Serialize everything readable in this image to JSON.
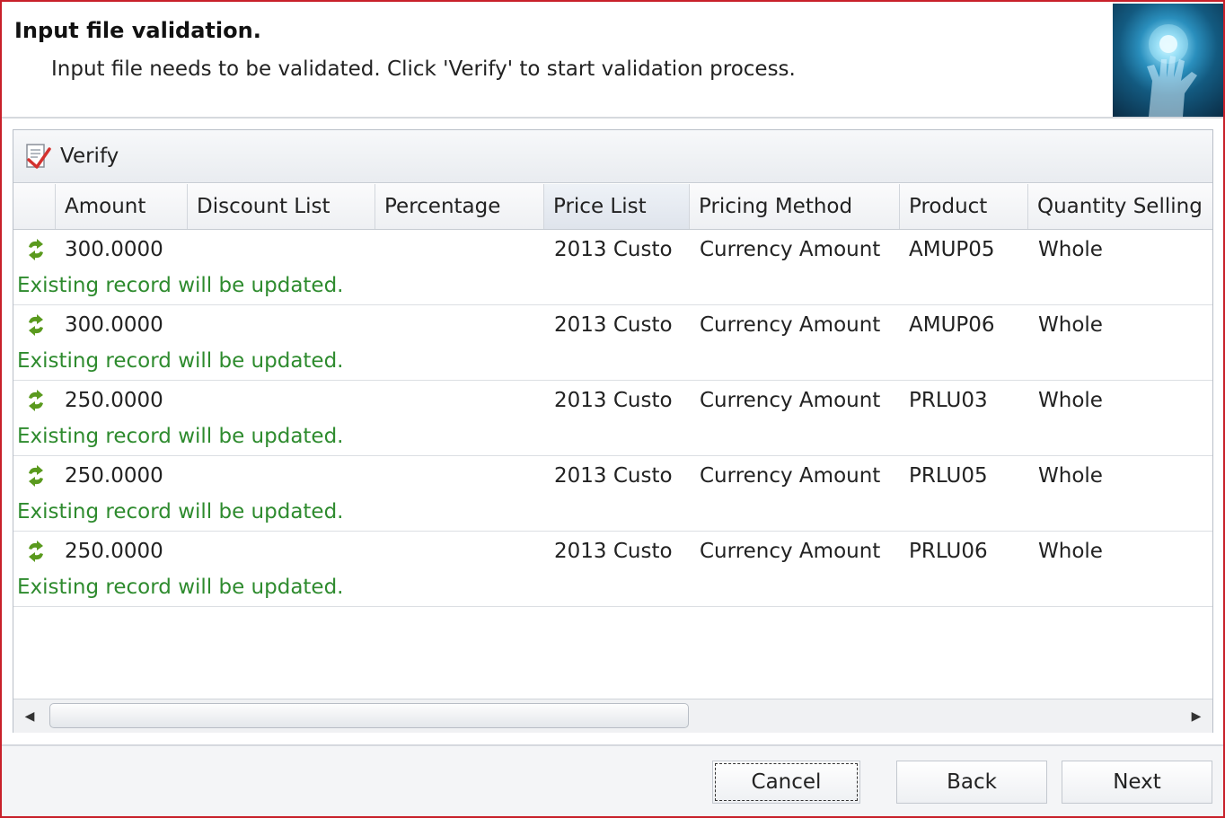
{
  "header": {
    "title": "Input file validation.",
    "description": "Input file needs to be validated. Click 'Verify' to start validation process."
  },
  "toolbar": {
    "verify_label": "Verify"
  },
  "grid": {
    "columns": [
      "Amount",
      "Discount List",
      "Percentage",
      "Price List",
      "Pricing Method",
      "Product",
      "Quantity Selling"
    ],
    "selected_column": "Price List",
    "rows": [
      {
        "amount": "300.0000",
        "discount_list": "",
        "percentage": "",
        "price_list": "2013 Custo",
        "pricing_method": "Currency Amount",
        "product": "AMUP05",
        "quantity_selling": "Whole",
        "message": "Existing record will be updated."
      },
      {
        "amount": "300.0000",
        "discount_list": "",
        "percentage": "",
        "price_list": "2013 Custo",
        "pricing_method": "Currency Amount",
        "product": "AMUP06",
        "quantity_selling": "Whole",
        "message": "Existing record will be updated."
      },
      {
        "amount": "250.0000",
        "discount_list": "",
        "percentage": "",
        "price_list": "2013 Custo",
        "pricing_method": "Currency Amount",
        "product": "PRLU03",
        "quantity_selling": "Whole",
        "message": "Existing record will be updated."
      },
      {
        "amount": "250.0000",
        "discount_list": "",
        "percentage": "",
        "price_list": "2013 Custo",
        "pricing_method": "Currency Amount",
        "product": "PRLU05",
        "quantity_selling": "Whole",
        "message": "Existing record will be updated."
      },
      {
        "amount": "250.0000",
        "discount_list": "",
        "percentage": "",
        "price_list": "2013 Custo",
        "pricing_method": "Currency Amount",
        "product": "PRLU06",
        "quantity_selling": "Whole",
        "message": "Existing record will be updated."
      }
    ],
    "row_icon": "update-icon",
    "message_color": "#2e8b2e"
  },
  "footer": {
    "cancel_label": "Cancel",
    "back_label": "Back",
    "next_label": "Next"
  },
  "colors": {
    "frame_border": "#c8202a",
    "update_icon": "#5a9a1e"
  }
}
